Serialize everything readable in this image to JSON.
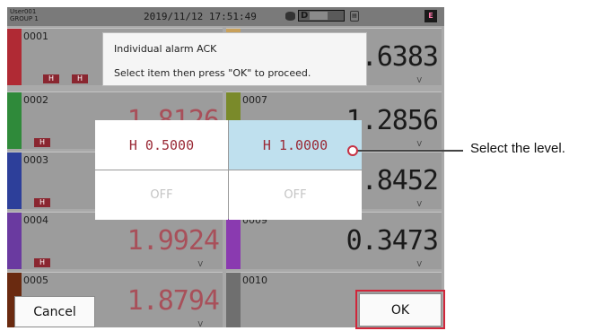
{
  "status": {
    "user": "User001",
    "group": "GROUP 1",
    "datetime": "2019/11/12 17:51:49",
    "memory_label": "D",
    "memory_fill_percent": 40,
    "small_icon": "fs-icon",
    "flag_label": "E"
  },
  "modal": {
    "title": "Individual alarm ACK",
    "message": "Select item then press \"OK\" to proceed."
  },
  "channels": [
    {
      "id": "0001",
      "value": "1.6383",
      "unit": "V",
      "bar_color": "#b02a34",
      "alarms": [
        "H",
        "H"
      ],
      "value_color": "dark"
    },
    {
      "id": "0002",
      "value": "1.8126",
      "unit": "V",
      "bar_color": "#2f8a3a",
      "alarms": [
        "H"
      ],
      "value_color": "red"
    },
    {
      "id": "0003",
      "value": "",
      "unit": "V",
      "bar_color": "#2d3f9a",
      "alarms": [
        "H"
      ],
      "value_color": "dark"
    },
    {
      "id": "0004",
      "value": "1.9924",
      "unit": "V",
      "bar_color": "#6a3aa0",
      "alarms": [
        "H"
      ],
      "value_color": "red"
    },
    {
      "id": "0005",
      "value": "1.8794",
      "unit": "V",
      "bar_color": "#6a2a10",
      "alarms": [
        "H"
      ],
      "value_color": "red"
    },
    {
      "id": "0007",
      "value": "1.2856",
      "unit": "V",
      "bar_color": "#7a8a2a",
      "alarms": [],
      "value_color": "dark"
    },
    {
      "id": "",
      "value": ").8452",
      "unit": "V",
      "bar_color": "#9c9c9c",
      "alarms": [],
      "value_color": "dark"
    },
    {
      "id": "0009",
      "value": "0.3473",
      "unit": "V",
      "bar_color": "#8a3ab0",
      "alarms": [],
      "value_color": "dark"
    },
    {
      "id": "0010",
      "value": "",
      "unit": "",
      "bar_color": "#6f6f6f",
      "alarms": [],
      "value_color": "dark"
    }
  ],
  "picker": {
    "options": [
      "H 0.5000",
      "H 1.0000",
      "OFF",
      "OFF"
    ],
    "selected_index": 1
  },
  "buttons": {
    "cancel": "Cancel",
    "ok": "OK"
  },
  "callout": {
    "text": "Select the level."
  }
}
